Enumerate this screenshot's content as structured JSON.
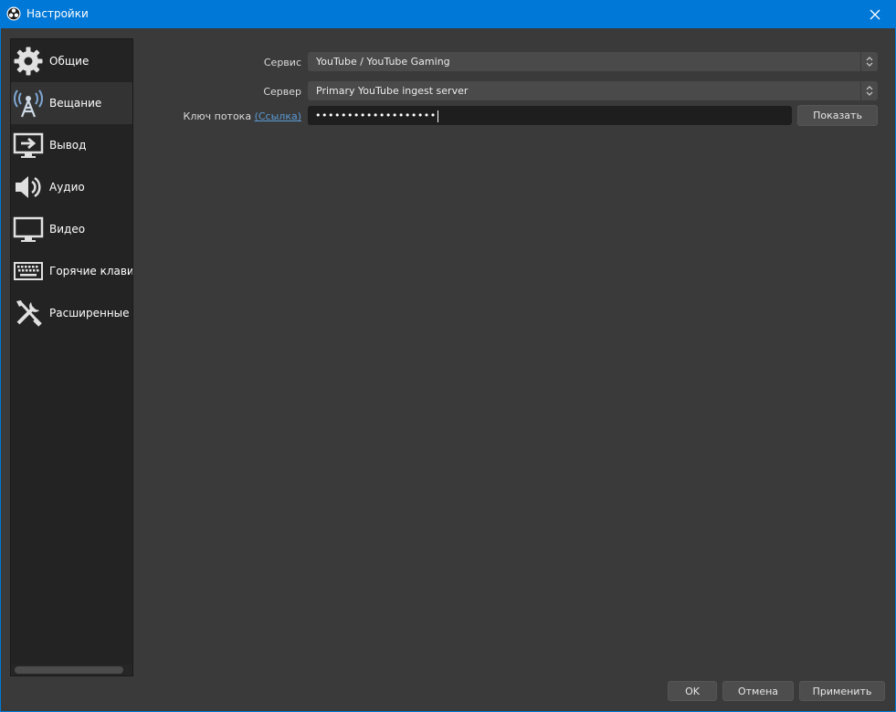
{
  "window": {
    "title": "Настройки",
    "app_icon": "obs-logo-icon",
    "close_icon": "close-icon"
  },
  "sidebar": {
    "items": [
      {
        "label": "Общие",
        "icon": "gear-icon",
        "active": false
      },
      {
        "label": "Вещание",
        "icon": "broadcast-antenna-icon",
        "active": true
      },
      {
        "label": "Вывод",
        "icon": "output-monitor-icon",
        "active": false
      },
      {
        "label": "Аудио",
        "icon": "speaker-icon",
        "active": false
      },
      {
        "label": "Видео",
        "icon": "monitor-icon",
        "active": false
      },
      {
        "label": "Горячие клавиши",
        "icon": "keyboard-icon",
        "active": false
      },
      {
        "label": "Расширенные",
        "icon": "tools-icon",
        "active": false
      }
    ]
  },
  "stream": {
    "service_label": "Сервис",
    "service_value": "YouTube / YouTube Gaming",
    "server_label": "Сервер",
    "server_value": "Primary YouTube ingest server",
    "key_label": "Ключ потока",
    "key_link": "(Ссылка)",
    "key_value": "•••••••••••••••••••",
    "show_button": "Показать"
  },
  "footer": {
    "ok": "OK",
    "cancel": "Отмена",
    "apply": "Применить"
  },
  "colors": {
    "titlebar": "#0078d7",
    "background": "#3a3a3a",
    "sidebar": "#232323",
    "link": "#5b9ad5"
  }
}
